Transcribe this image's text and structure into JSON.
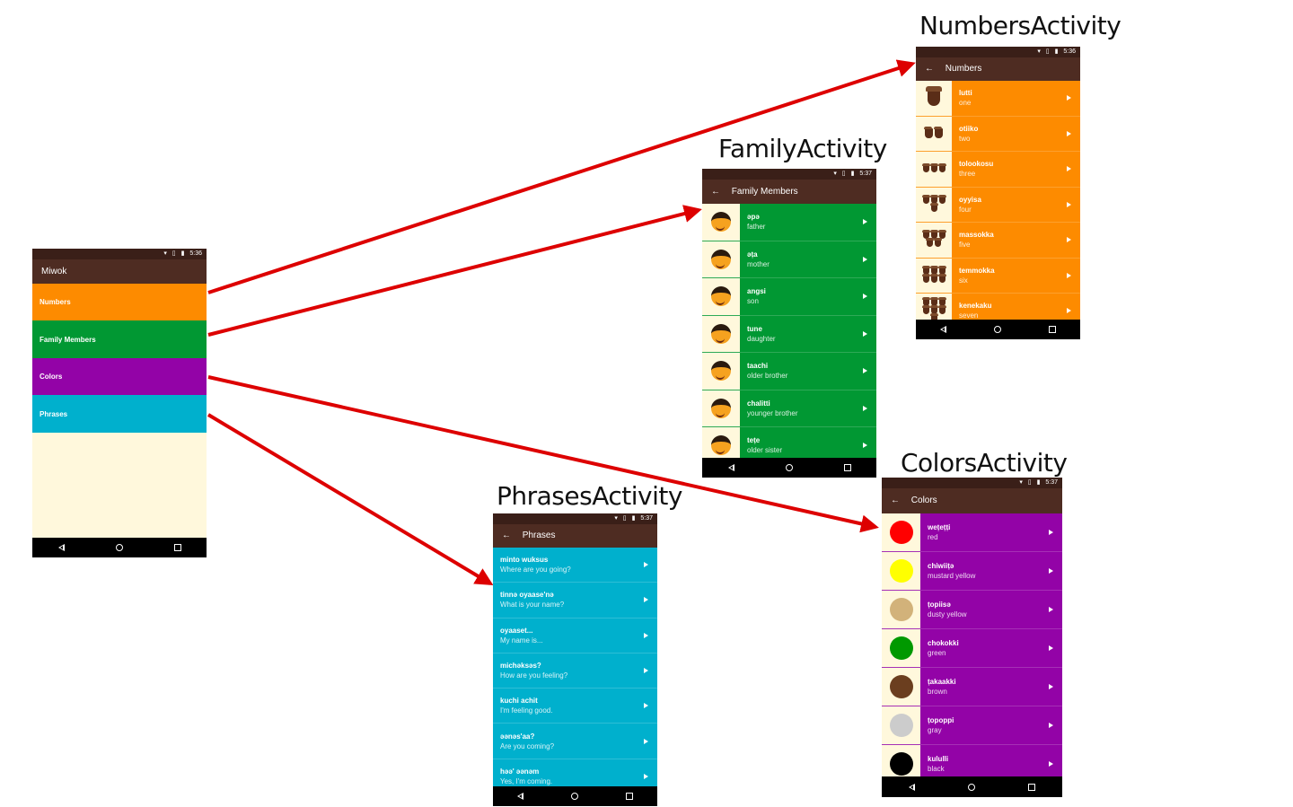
{
  "colors": {
    "numbers": "#fd8b00",
    "family": "#019833",
    "colors": "#9303a7",
    "phrases": "#00b0cd",
    "appbar": "#4e2c22",
    "arrow": "#dd0000",
    "background": "#fff8dc"
  },
  "status_time_home": "5:36",
  "home": {
    "title": "Miwok",
    "items": [
      {
        "label": "Numbers",
        "color": "#fd8b00"
      },
      {
        "label": "Family Members",
        "color": "#019833"
      },
      {
        "label": "Colors",
        "color": "#9303a7"
      },
      {
        "label": "Phrases",
        "color": "#00b0cd"
      }
    ]
  },
  "numbers_activity": {
    "caption": "NumbersActivity",
    "time": "5:36",
    "title": "Numbers",
    "rows": [
      {
        "miwok": "lutti",
        "english": "one",
        "count": 1
      },
      {
        "miwok": "otiiko",
        "english": "two",
        "count": 2
      },
      {
        "miwok": "tolookosu",
        "english": "three",
        "count": 3
      },
      {
        "miwok": "oyyisa",
        "english": "four",
        "count": 4
      },
      {
        "miwok": "massokka",
        "english": "five",
        "count": 5
      },
      {
        "miwok": "temmokka",
        "english": "six",
        "count": 6
      },
      {
        "miwok": "kenekaku",
        "english": "seven",
        "count": 7
      }
    ]
  },
  "family_activity": {
    "caption": "FamilyActivity",
    "time": "5:37",
    "title": "Family Members",
    "rows": [
      {
        "miwok": "әpә",
        "english": "father"
      },
      {
        "miwok": "әṭa",
        "english": "mother"
      },
      {
        "miwok": "angsi",
        "english": "son"
      },
      {
        "miwok": "tune",
        "english": "daughter"
      },
      {
        "miwok": "taachi",
        "english": "older brother"
      },
      {
        "miwok": "chalitti",
        "english": "younger brother"
      },
      {
        "miwok": "teṭe",
        "english": "older sister"
      }
    ]
  },
  "colors_activity": {
    "caption": "ColorsActivity",
    "time": "5:37",
    "title": "Colors",
    "rows": [
      {
        "miwok": "weṭeṭṭi",
        "english": "red",
        "swatch": "#ff0000"
      },
      {
        "miwok": "chiwiiṭә",
        "english": "mustard yellow",
        "swatch": "#ffff00"
      },
      {
        "miwok": "ṭopiisә",
        "english": "dusty yellow",
        "swatch": "#d2b27a"
      },
      {
        "miwok": "chokokki",
        "english": "green",
        "swatch": "#009900"
      },
      {
        "miwok": "ṭakaakki",
        "english": "brown",
        "swatch": "#6b3e1f"
      },
      {
        "miwok": "ṭopoppi",
        "english": "gray",
        "swatch": "#cccccc"
      },
      {
        "miwok": "kululli",
        "english": "black",
        "swatch": "#000000"
      }
    ]
  },
  "phrases_activity": {
    "caption": "PhrasesActivity",
    "time": "5:37",
    "title": "Phrases",
    "rows": [
      {
        "miwok": "minto wuksus",
        "english": "Where are you going?"
      },
      {
        "miwok": "tinnә oyaase'nә",
        "english": "What is your name?"
      },
      {
        "miwok": "oyaaset...",
        "english": "My name is..."
      },
      {
        "miwok": "michәksәs?",
        "english": "How are you feeling?"
      },
      {
        "miwok": "kuchi achit",
        "english": "I'm feeling good."
      },
      {
        "miwok": "әәnәs'aa?",
        "english": "Are you coming?"
      },
      {
        "miwok": "hәә' әәnәm",
        "english": "Yes, I'm coming."
      }
    ]
  }
}
